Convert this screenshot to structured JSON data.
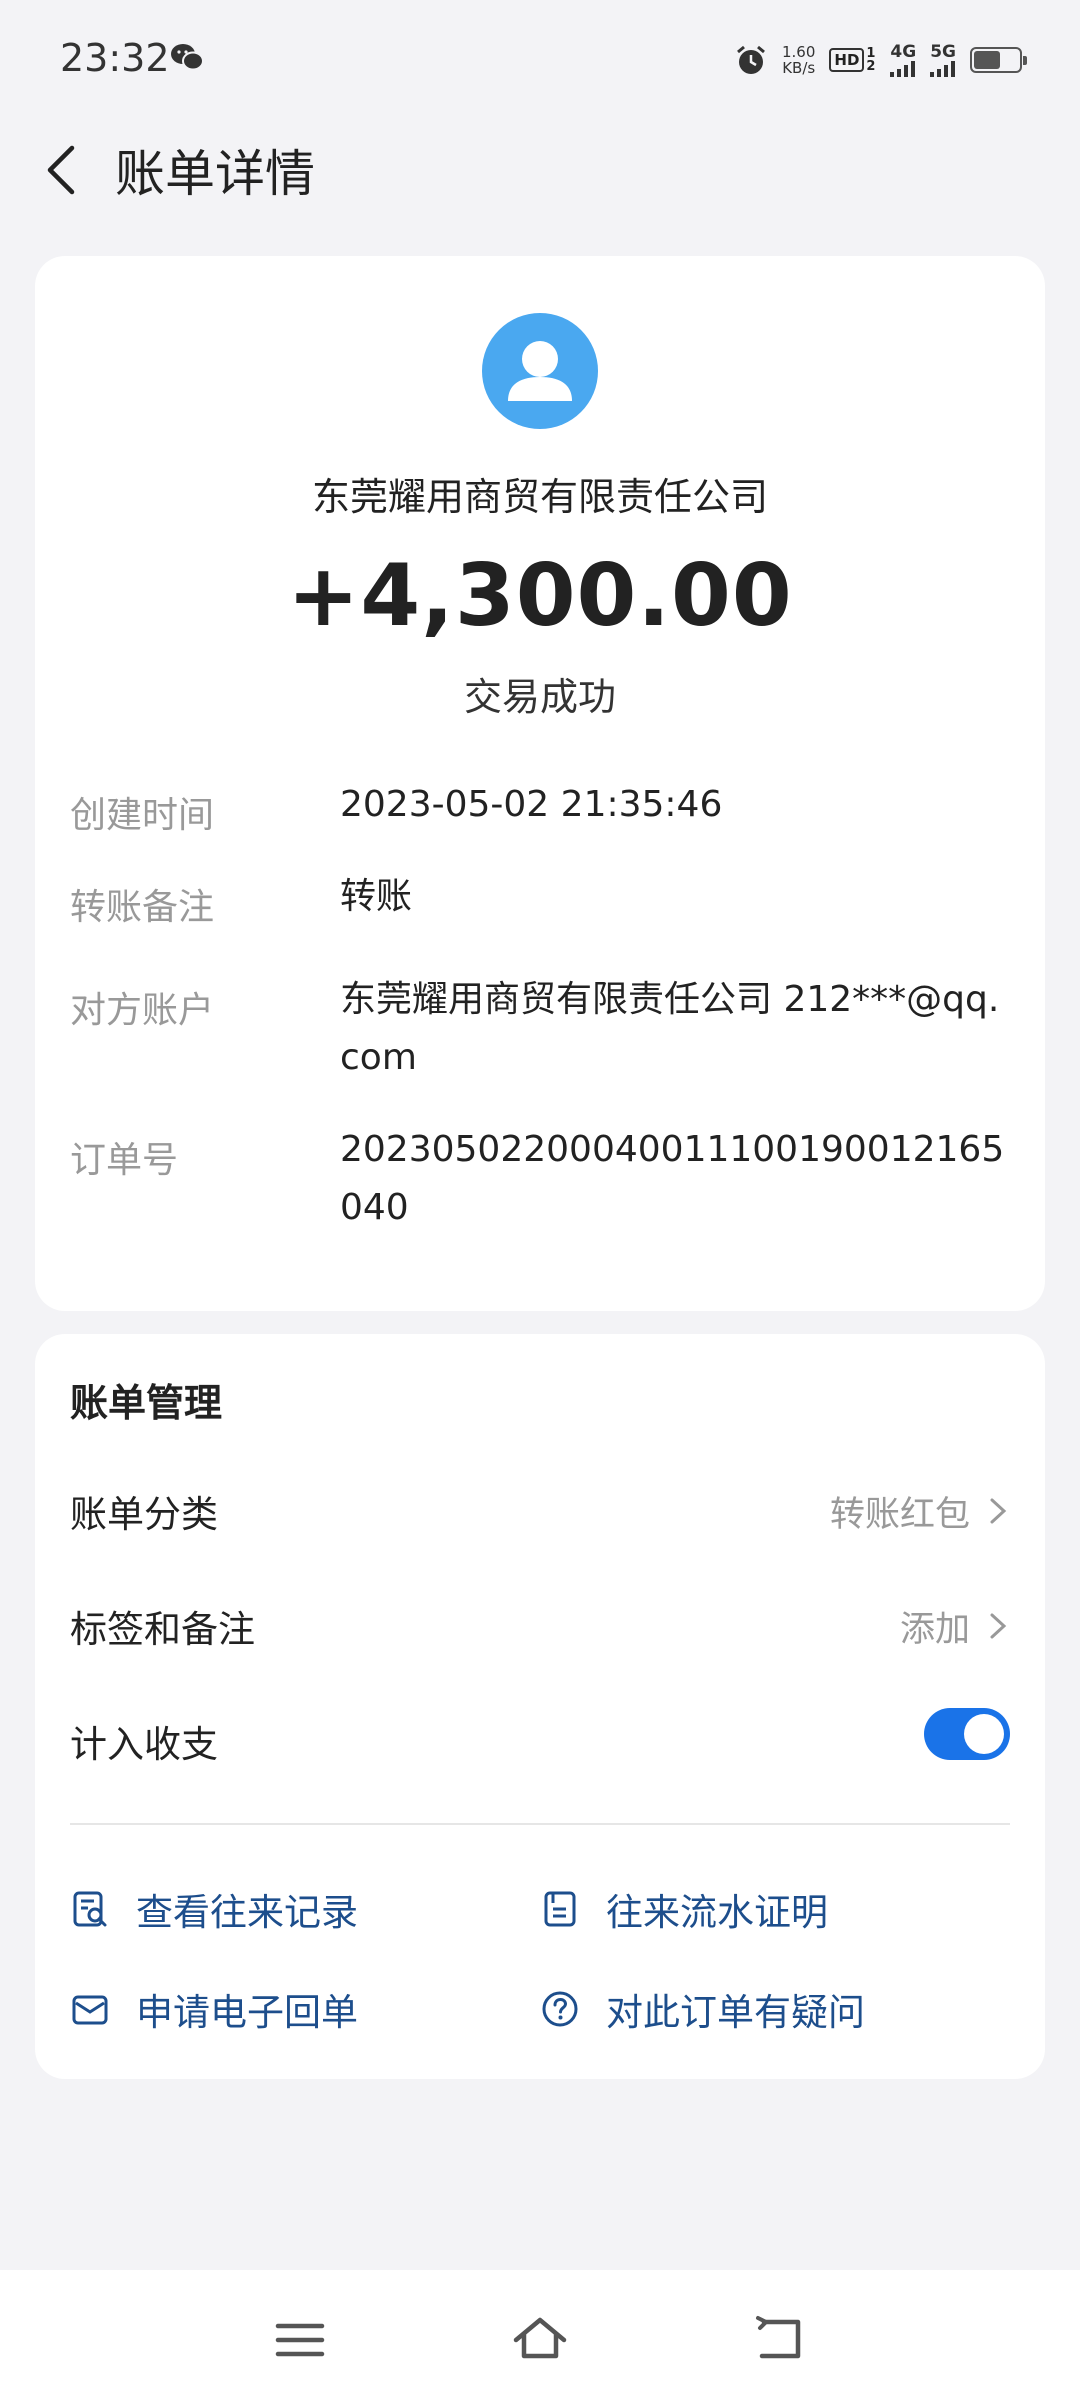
{
  "status_bar": {
    "time": "23:32",
    "speed_value": "1.60",
    "speed_unit": "KB/s",
    "hd": "HD",
    "hd_sub": "1 2",
    "net1": "4G",
    "net2": "5G"
  },
  "header": {
    "title": "账单详情"
  },
  "transaction": {
    "payee": "东莞耀用商贸有限责任公司",
    "amount": "+4,300.00",
    "status": "交易成功",
    "details": [
      {
        "label": "创建时间",
        "value": "2023-05-02 21:35:46"
      },
      {
        "label": "转账备注",
        "value": "转账"
      },
      {
        "label": "对方账户",
        "value": "东莞耀用商贸有限责任公司 212***@qq.com"
      },
      {
        "label": "订单号",
        "value": "20230502200040011100190012165040"
      }
    ]
  },
  "management": {
    "title": "账单管理",
    "category_label": "账单分类",
    "category_value": "转账红包",
    "tags_label": "标签和备注",
    "tags_value": "添加",
    "count_label": "计入收支",
    "count_enabled": true,
    "actions": [
      {
        "label": "查看往来记录",
        "icon": "record-search-icon"
      },
      {
        "label": "往来流水证明",
        "icon": "document-icon"
      },
      {
        "label": "申请电子回单",
        "icon": "mail-icon"
      },
      {
        "label": "对此订单有疑问",
        "icon": "question-icon"
      }
    ]
  },
  "colors": {
    "accent": "#1a73e8",
    "link": "#1d4e8c",
    "avatar": "#4aa8f0"
  }
}
